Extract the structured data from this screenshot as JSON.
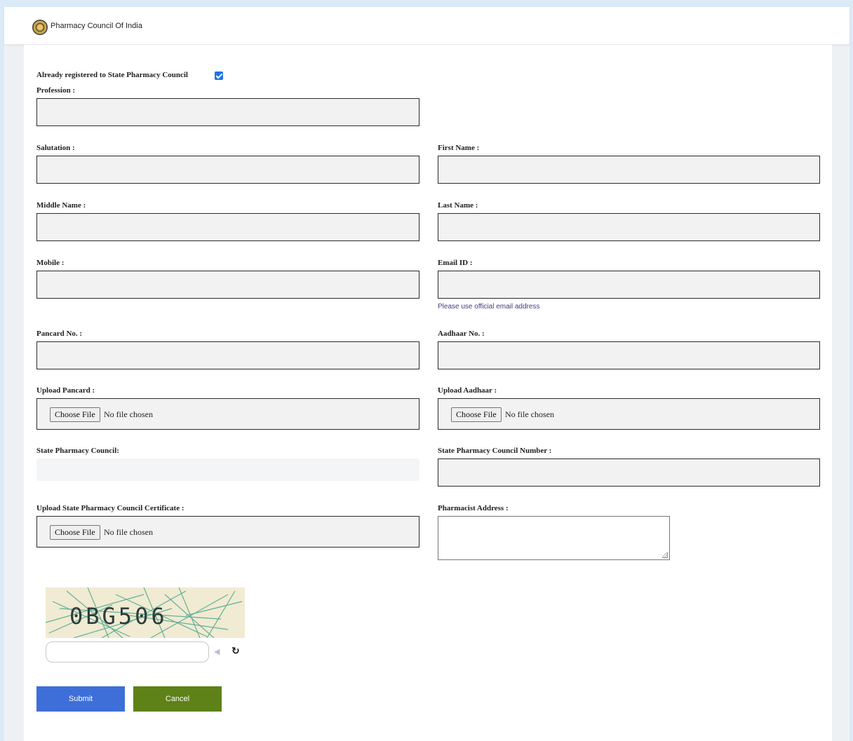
{
  "header": {
    "brand": "Pharmacy Council Of India"
  },
  "form": {
    "already_registered_label": "Already registered to State Pharmacy Council",
    "already_registered_checked": true,
    "profession_label": "Profession :",
    "salutation_label": "Salutation :",
    "first_name_label": "First Name :",
    "middle_name_label": "Middle Name :",
    "last_name_label": "Last Name :",
    "mobile_label": "Mobile :",
    "email_label": "Email ID :",
    "email_hint": "Please use official email address",
    "pancard_label": "Pancard No. :",
    "aadhaar_label": "Aadhaar No. :",
    "upload_pancard_label": "Upload Pancard :",
    "upload_aadhaar_label": "Upload Aadhaar :",
    "choose_file": "Choose File",
    "no_file": "No file chosen",
    "state_council_label": "State Pharmacy Council:",
    "state_council_number_label": "State Pharmacy Council Number :",
    "upload_certificate_label": "Upload State Pharmacy Council Certificate :",
    "address_label": "Pharmacist Address :"
  },
  "captcha": {
    "text": "0BG506"
  },
  "buttons": {
    "submit": "Submit",
    "cancel": "Cancel"
  }
}
